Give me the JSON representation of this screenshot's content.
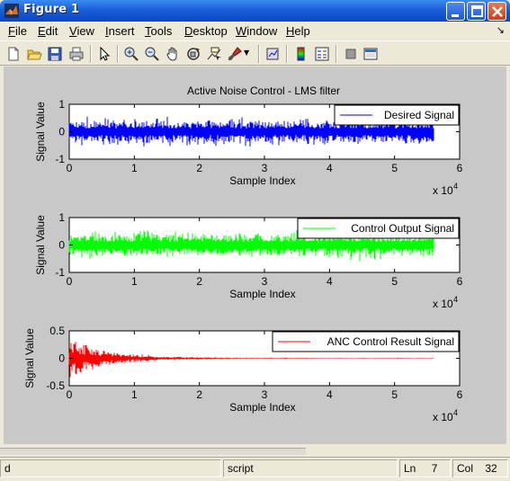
{
  "window": {
    "title": "Figure 1"
  },
  "menu": {
    "items": [
      "File",
      "Edit",
      "View",
      "Insert",
      "Tools",
      "Desktop",
      "Window",
      "Help"
    ]
  },
  "toolbar": {
    "icons": [
      "new-figure-icon",
      "open-file-icon",
      "save-icon",
      "print-icon",
      "edit-plot-arrow-icon",
      "zoom-in-icon",
      "zoom-out-icon",
      "pan-hand-icon",
      "rotate-3d-icon",
      "data-cursor-icon",
      "brush-icon",
      "link-plot-icon",
      "insert-colorbar-icon",
      "insert-legend-icon",
      "hide-plot-tools-icon",
      "show-plot-tools-icon"
    ]
  },
  "figure": {
    "title": "Active Noise Control - LMS filter"
  },
  "chart_data": [
    {
      "type": "line",
      "title": "Active Noise Control - LMS filter",
      "xlabel": "Sample Index",
      "ylabel": "Signal Value",
      "x_multiplier": "x 10",
      "x_multiplier_exp": "4",
      "xlim": [
        0,
        60000
      ],
      "ylim": [
        -1,
        1
      ],
      "xticks": [
        "0",
        "1",
        "2",
        "3",
        "4",
        "5",
        "6"
      ],
      "yticks": [
        "1",
        "0",
        "-1"
      ],
      "legend": "top-right",
      "series": [
        {
          "name": "Desired Signal",
          "color": "#0000ff",
          "n_samples": 56000,
          "approx_amplitude": 0.4,
          "envelope": "steady"
        }
      ]
    },
    {
      "type": "line",
      "xlabel": "Sample Index",
      "ylabel": "Signal Value",
      "x_multiplier": "x 10",
      "x_multiplier_exp": "4",
      "xlim": [
        0,
        60000
      ],
      "ylim": [
        -1,
        1
      ],
      "xticks": [
        "0",
        "1",
        "2",
        "3",
        "4",
        "5",
        "6"
      ],
      "yticks": [
        "1",
        "0",
        "-1"
      ],
      "legend": "top-right",
      "series": [
        {
          "name": "Control Output Signal",
          "color": "#00ff00",
          "n_samples": 56000,
          "approx_amplitude": 0.4,
          "envelope": "steady"
        }
      ]
    },
    {
      "type": "line",
      "xlabel": "Sample Index",
      "ylabel": "Signal Value",
      "x_multiplier": "x 10",
      "x_multiplier_exp": "4",
      "xlim": [
        0,
        60000
      ],
      "ylim": [
        -0.5,
        0.5
      ],
      "xticks": [
        "0",
        "1",
        "2",
        "3",
        "4",
        "5",
        "6"
      ],
      "yticks": [
        "0.5",
        "0",
        "-0.5"
      ],
      "legend": "top-right",
      "series": [
        {
          "name": "ANC Control Result Signal",
          "color": "#ff0000",
          "n_samples": 56000,
          "approx_amplitude": 0.3,
          "envelope": "decaying"
        }
      ]
    }
  ],
  "status": {
    "left": "d",
    "mode": "script",
    "ln_label": "Ln",
    "ln_value": "7",
    "col_label": "Col",
    "col_value": "32"
  }
}
